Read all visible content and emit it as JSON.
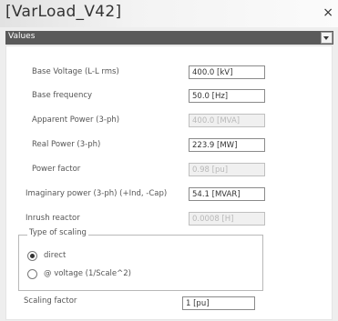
{
  "window": {
    "title": "[VarLoad_V42]",
    "close_glyph": "×"
  },
  "section": {
    "label": "Values"
  },
  "fields": [
    {
      "label": "Base Voltage (L-L rms)",
      "value": "400.0 [kV]",
      "enabled": true
    },
    {
      "label": "Base frequency",
      "value": "50.0 [Hz]",
      "enabled": true
    },
    {
      "label": "Apparent Power (3-ph)",
      "value": "400.0 [MVA]",
      "enabled": false
    },
    {
      "label": "Real Power (3-ph)",
      "value": "223.9 [MW]",
      "enabled": true
    },
    {
      "label": "Power factor",
      "value": "0.98 [pu]",
      "enabled": false
    },
    {
      "label": "Imaginary power (3-ph) (+Ind, -Cap)",
      "value": "54.1 [MVAR]",
      "enabled": true
    },
    {
      "label": "Inrush reactor",
      "value": "0.0008 [H]",
      "enabled": false
    }
  ],
  "scaling_group": {
    "legend": "Type of scaling",
    "options": [
      {
        "label": "direct",
        "checked": true
      },
      {
        "label": "@ voltage (1/Scale^2)",
        "checked": false
      }
    ]
  },
  "scaling_factor": {
    "label": "Scaling factor",
    "value": "1 [pu]"
  }
}
